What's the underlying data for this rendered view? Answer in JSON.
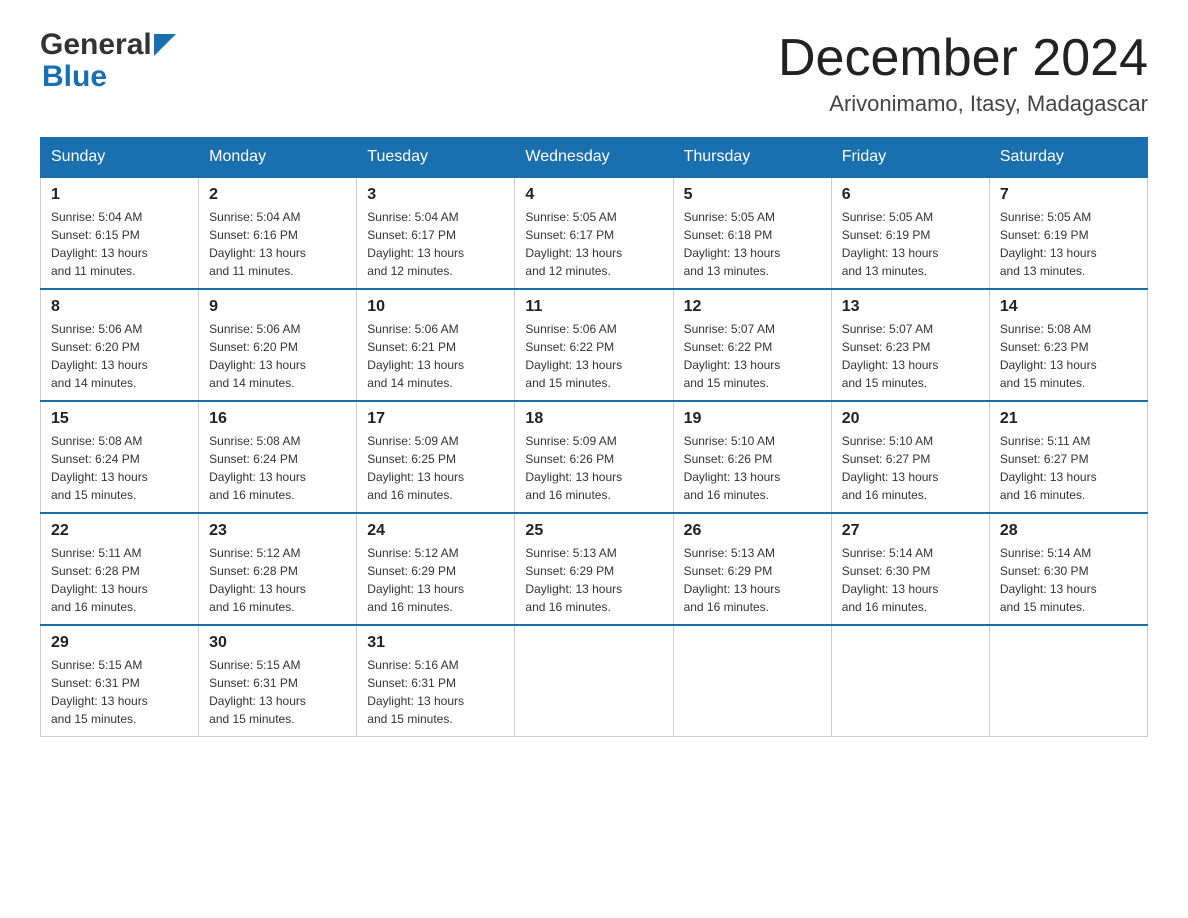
{
  "logo": {
    "general": "General",
    "blue": "Blue"
  },
  "title": "December 2024",
  "location": "Arivonimamo, Itasy, Madagascar",
  "days_of_week": [
    "Sunday",
    "Monday",
    "Tuesday",
    "Wednesday",
    "Thursday",
    "Friday",
    "Saturday"
  ],
  "weeks": [
    [
      {
        "day": "1",
        "sunrise": "5:04 AM",
        "sunset": "6:15 PM",
        "daylight": "13 hours and 11 minutes."
      },
      {
        "day": "2",
        "sunrise": "5:04 AM",
        "sunset": "6:16 PM",
        "daylight": "13 hours and 11 minutes."
      },
      {
        "day": "3",
        "sunrise": "5:04 AM",
        "sunset": "6:17 PM",
        "daylight": "13 hours and 12 minutes."
      },
      {
        "day": "4",
        "sunrise": "5:05 AM",
        "sunset": "6:17 PM",
        "daylight": "13 hours and 12 minutes."
      },
      {
        "day": "5",
        "sunrise": "5:05 AM",
        "sunset": "6:18 PM",
        "daylight": "13 hours and 13 minutes."
      },
      {
        "day": "6",
        "sunrise": "5:05 AM",
        "sunset": "6:19 PM",
        "daylight": "13 hours and 13 minutes."
      },
      {
        "day": "7",
        "sunrise": "5:05 AM",
        "sunset": "6:19 PM",
        "daylight": "13 hours and 13 minutes."
      }
    ],
    [
      {
        "day": "8",
        "sunrise": "5:06 AM",
        "sunset": "6:20 PM",
        "daylight": "13 hours and 14 minutes."
      },
      {
        "day": "9",
        "sunrise": "5:06 AM",
        "sunset": "6:20 PM",
        "daylight": "13 hours and 14 minutes."
      },
      {
        "day": "10",
        "sunrise": "5:06 AM",
        "sunset": "6:21 PM",
        "daylight": "13 hours and 14 minutes."
      },
      {
        "day": "11",
        "sunrise": "5:06 AM",
        "sunset": "6:22 PM",
        "daylight": "13 hours and 15 minutes."
      },
      {
        "day": "12",
        "sunrise": "5:07 AM",
        "sunset": "6:22 PM",
        "daylight": "13 hours and 15 minutes."
      },
      {
        "day": "13",
        "sunrise": "5:07 AM",
        "sunset": "6:23 PM",
        "daylight": "13 hours and 15 minutes."
      },
      {
        "day": "14",
        "sunrise": "5:08 AM",
        "sunset": "6:23 PM",
        "daylight": "13 hours and 15 minutes."
      }
    ],
    [
      {
        "day": "15",
        "sunrise": "5:08 AM",
        "sunset": "6:24 PM",
        "daylight": "13 hours and 15 minutes."
      },
      {
        "day": "16",
        "sunrise": "5:08 AM",
        "sunset": "6:24 PM",
        "daylight": "13 hours and 16 minutes."
      },
      {
        "day": "17",
        "sunrise": "5:09 AM",
        "sunset": "6:25 PM",
        "daylight": "13 hours and 16 minutes."
      },
      {
        "day": "18",
        "sunrise": "5:09 AM",
        "sunset": "6:26 PM",
        "daylight": "13 hours and 16 minutes."
      },
      {
        "day": "19",
        "sunrise": "5:10 AM",
        "sunset": "6:26 PM",
        "daylight": "13 hours and 16 minutes."
      },
      {
        "day": "20",
        "sunrise": "5:10 AM",
        "sunset": "6:27 PM",
        "daylight": "13 hours and 16 minutes."
      },
      {
        "day": "21",
        "sunrise": "5:11 AM",
        "sunset": "6:27 PM",
        "daylight": "13 hours and 16 minutes."
      }
    ],
    [
      {
        "day": "22",
        "sunrise": "5:11 AM",
        "sunset": "6:28 PM",
        "daylight": "13 hours and 16 minutes."
      },
      {
        "day": "23",
        "sunrise": "5:12 AM",
        "sunset": "6:28 PM",
        "daylight": "13 hours and 16 minutes."
      },
      {
        "day": "24",
        "sunrise": "5:12 AM",
        "sunset": "6:29 PM",
        "daylight": "13 hours and 16 minutes."
      },
      {
        "day": "25",
        "sunrise": "5:13 AM",
        "sunset": "6:29 PM",
        "daylight": "13 hours and 16 minutes."
      },
      {
        "day": "26",
        "sunrise": "5:13 AM",
        "sunset": "6:29 PM",
        "daylight": "13 hours and 16 minutes."
      },
      {
        "day": "27",
        "sunrise": "5:14 AM",
        "sunset": "6:30 PM",
        "daylight": "13 hours and 16 minutes."
      },
      {
        "day": "28",
        "sunrise": "5:14 AM",
        "sunset": "6:30 PM",
        "daylight": "13 hours and 15 minutes."
      }
    ],
    [
      {
        "day": "29",
        "sunrise": "5:15 AM",
        "sunset": "6:31 PM",
        "daylight": "13 hours and 15 minutes."
      },
      {
        "day": "30",
        "sunrise": "5:15 AM",
        "sunset": "6:31 PM",
        "daylight": "13 hours and 15 minutes."
      },
      {
        "day": "31",
        "sunrise": "5:16 AM",
        "sunset": "6:31 PM",
        "daylight": "13 hours and 15 minutes."
      },
      null,
      null,
      null,
      null
    ]
  ],
  "labels": {
    "sunrise": "Sunrise: ",
    "sunset": "Sunset: ",
    "daylight": "Daylight: "
  }
}
